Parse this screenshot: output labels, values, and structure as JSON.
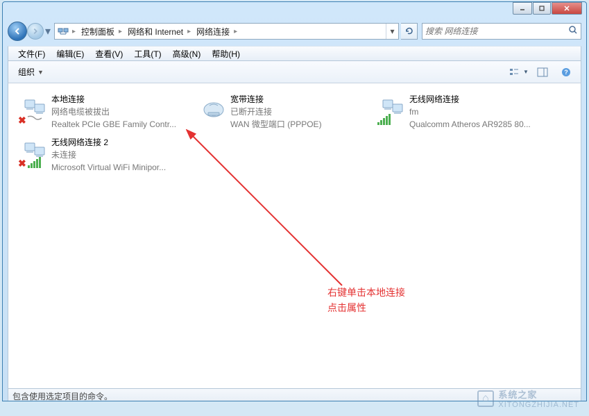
{
  "window": {
    "min_tip": "最小化",
    "max_tip": "最大化",
    "close_tip": "关闭"
  },
  "address": {
    "root_sep": "▸",
    "seg1": "控制面板",
    "seg2": "网络和 Internet",
    "seg3": "网络连接"
  },
  "search": {
    "placeholder": "搜索 网络连接"
  },
  "menu": {
    "file": "文件(F)",
    "edit": "编辑(E)",
    "view": "查看(V)",
    "tools": "工具(T)",
    "advanced": "高级(N)",
    "help": "帮助(H)"
  },
  "toolbar": {
    "organize": "组织"
  },
  "connections": [
    {
      "name": "本地连接",
      "status": "网络电缆被拔出",
      "device": "Realtek PCIe GBE Family Contr...",
      "icon": "ethernet-disconnected"
    },
    {
      "name": "宽带连接",
      "status": "已断开连接",
      "device": "WAN 微型端口 (PPPOE)",
      "icon": "wan"
    },
    {
      "name": "无线网络连接",
      "status": "fm",
      "device": "Qualcomm Atheros AR9285 80...",
      "icon": "wifi-connected"
    },
    {
      "name": "无线网络连接 2",
      "status": "未连接",
      "device": "Microsoft Virtual WiFi Minipor...",
      "icon": "wifi-disconnected"
    }
  ],
  "annotation": {
    "line1": "右键单击本地连接",
    "line2": "点击属性"
  },
  "statusbar": {
    "text": "包含使用选定项目的命令。"
  },
  "watermark": {
    "brand": "系统之家",
    "url": "XITONGZHIJIA.NET"
  }
}
